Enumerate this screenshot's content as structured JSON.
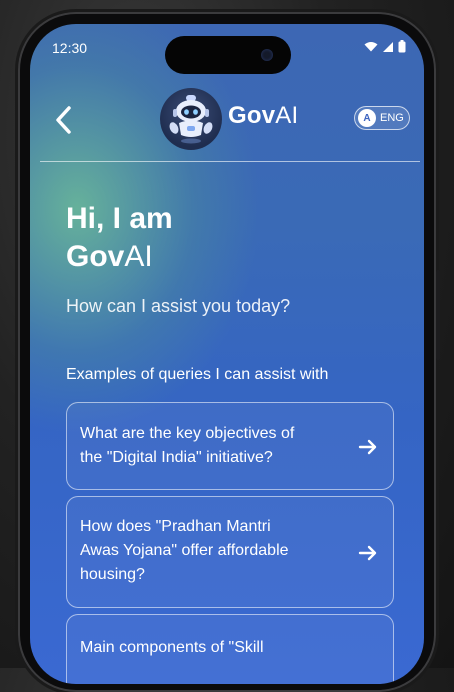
{
  "status_bar": {
    "time": "12:30"
  },
  "header": {
    "brand_bold": "Gov",
    "brand_light": "AI",
    "language_badge": "A",
    "language_label": "ENG"
  },
  "hero": {
    "line1": "Hi, I am",
    "line2_bold": "Gov",
    "line2_light": "AI",
    "subtitle": "How can I assist you today?"
  },
  "examples": {
    "title": "Examples of queries I can assist with",
    "items": [
      {
        "line1": "What are the key objectives of",
        "line2": "the \"Digital India\" initiative?",
        "line3": ""
      },
      {
        "line1": "How does \"Pradhan Mantri",
        "line2": "Awas Yojana\" offer affordable",
        "line3": "housing?"
      },
      {
        "line1": "Main components of \"Skill",
        "line2": "",
        "line3": ""
      }
    ]
  },
  "icons": {
    "back": "chevron-left-icon",
    "avatar": "robot-icon",
    "arrow": "arrow-right-icon",
    "wifi": "wifi-icon",
    "signal": "signal-icon",
    "battery": "battery-icon"
  },
  "colors": {
    "gradient_top": "#3d67b4",
    "gradient_bottom": "#3a69d2",
    "green_glow": "#6ebe96",
    "text": "#ffffff"
  }
}
